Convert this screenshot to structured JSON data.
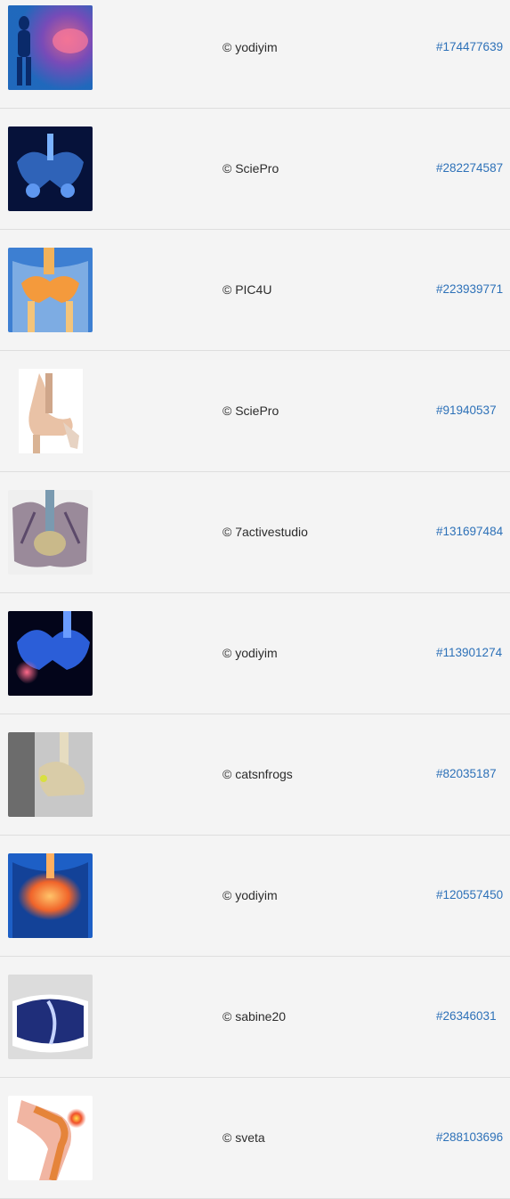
{
  "results": [
    {
      "credit": "© yodiyim",
      "asset_id": "#174477639",
      "thumb_icon": "pelvis-xray-blue-red-icon"
    },
    {
      "credit": "© SciePro",
      "asset_id": "#282274587",
      "thumb_icon": "pelvis-xray-blue-icon"
    },
    {
      "credit": "© PIC4U",
      "asset_id": "#223939771",
      "thumb_icon": "pelvis-orange-skeleton-icon"
    },
    {
      "credit": "© SciePro",
      "asset_id": "#91940537",
      "thumb_icon": "seated-skeleton-icon"
    },
    {
      "credit": "© 7activestudio",
      "asset_id": "#131697484",
      "thumb_icon": "pelvis-anatomy-purple-icon"
    },
    {
      "credit": "© yodiyim",
      "asset_id": "#113901274",
      "thumb_icon": "hip-xray-blue-red-icon"
    },
    {
      "credit": "© catsnfrogs",
      "asset_id": "#82035187",
      "thumb_icon": "pelvis-3d-grey-icon"
    },
    {
      "credit": "© yodiyim",
      "asset_id": "#120557450",
      "thumb_icon": "pelvis-xray-orange-glow-icon"
    },
    {
      "credit": "© sabine20",
      "asset_id": "#26346031",
      "thumb_icon": "pelvic-cushion-icon"
    },
    {
      "credit": "© sveta",
      "asset_id": "#288103696",
      "thumb_icon": "knee-joint-pain-icon"
    }
  ]
}
